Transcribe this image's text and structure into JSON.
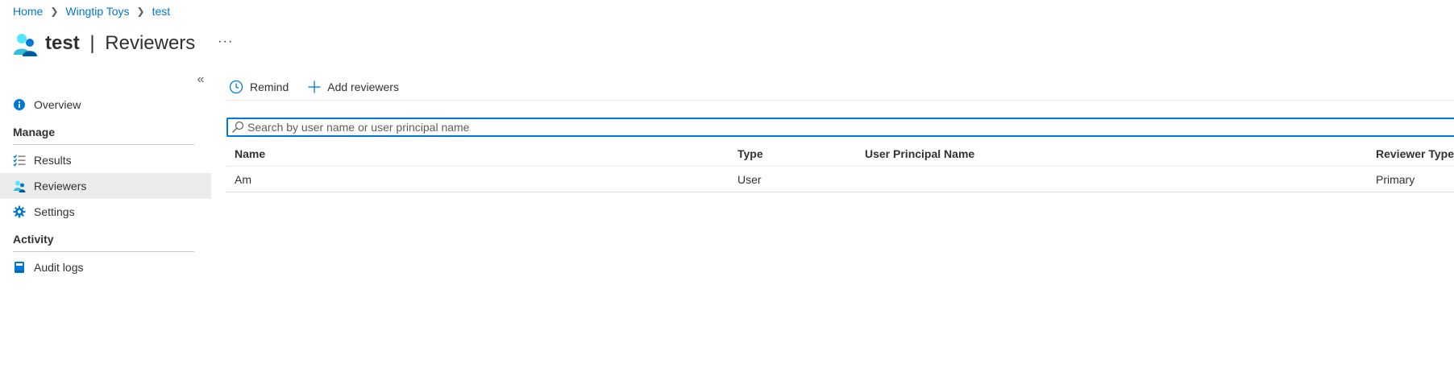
{
  "breadcrumb": {
    "items": [
      "Home",
      "Wingtip Toys",
      "test"
    ]
  },
  "header": {
    "title_bold": "test",
    "title_sep": "|",
    "title_rest": "Reviewers",
    "more_label": "···"
  },
  "sidebar": {
    "collapse_label": "«",
    "top_items": [
      {
        "label": "Overview",
        "icon": "info-icon"
      }
    ],
    "sections": [
      {
        "title": "Manage",
        "items": [
          {
            "label": "Results",
            "icon": "checklist-icon"
          },
          {
            "label": "Reviewers",
            "icon": "reviewers-icon",
            "active": true
          },
          {
            "label": "Settings",
            "icon": "gear-icon"
          }
        ]
      },
      {
        "title": "Activity",
        "items": [
          {
            "label": "Audit logs",
            "icon": "book-icon"
          }
        ]
      }
    ]
  },
  "toolbar": {
    "remind_label": "Remind",
    "add_reviewers_label": "Add reviewers"
  },
  "search": {
    "placeholder": "Search by user name or user principal name",
    "value": ""
  },
  "table": {
    "columns": [
      "Name",
      "Type",
      "User Principal Name",
      "Reviewer Type"
    ],
    "rows": [
      {
        "name": "Am",
        "type": "User",
        "upn": "",
        "reviewer_type": "Primary"
      }
    ]
  },
  "colors": {
    "accent": "#0078d4",
    "active_bg": "#edebe9",
    "text": "#323130"
  }
}
